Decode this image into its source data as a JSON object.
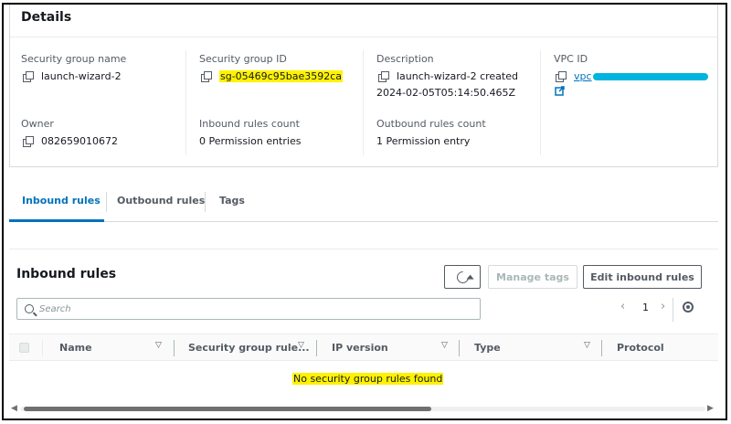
{
  "details": {
    "title": "Details",
    "security_group_name_label": "Security group name",
    "security_group_name": "launch-wizard-2",
    "security_group_id_label": "Security group ID",
    "security_group_id": "sg-05469c95bae3592ca",
    "description_label": "Description",
    "description_line1": "launch-wizard-2 created",
    "description_line2": "2024-02-05T05:14:50.465Z",
    "vpc_id_label": "VPC ID",
    "vpc_id_prefix": "vpc",
    "owner_label": "Owner",
    "owner": "082659010672",
    "inbound_count_label": "Inbound rules count",
    "inbound_count": "0 Permission entries",
    "outbound_count_label": "Outbound rules count",
    "outbound_count": "1 Permission entry"
  },
  "tabs": [
    {
      "label": "Inbound rules",
      "active": true
    },
    {
      "label": "Outbound rules",
      "active": false
    },
    {
      "label": "Tags",
      "active": false
    }
  ],
  "rules": {
    "title": "Inbound rules",
    "manage_tags_label": "Manage tags",
    "edit_label": "Edit inbound rules",
    "search_placeholder": "Search",
    "page_number": "1",
    "columns": [
      "Name",
      "Security group rule...",
      "IP version",
      "Type",
      "Protocol"
    ],
    "empty_message": "No security group rules found"
  },
  "colors": {
    "accent": "#0073bb",
    "highlight": "#fff200",
    "redaction": "#00b4e0"
  }
}
